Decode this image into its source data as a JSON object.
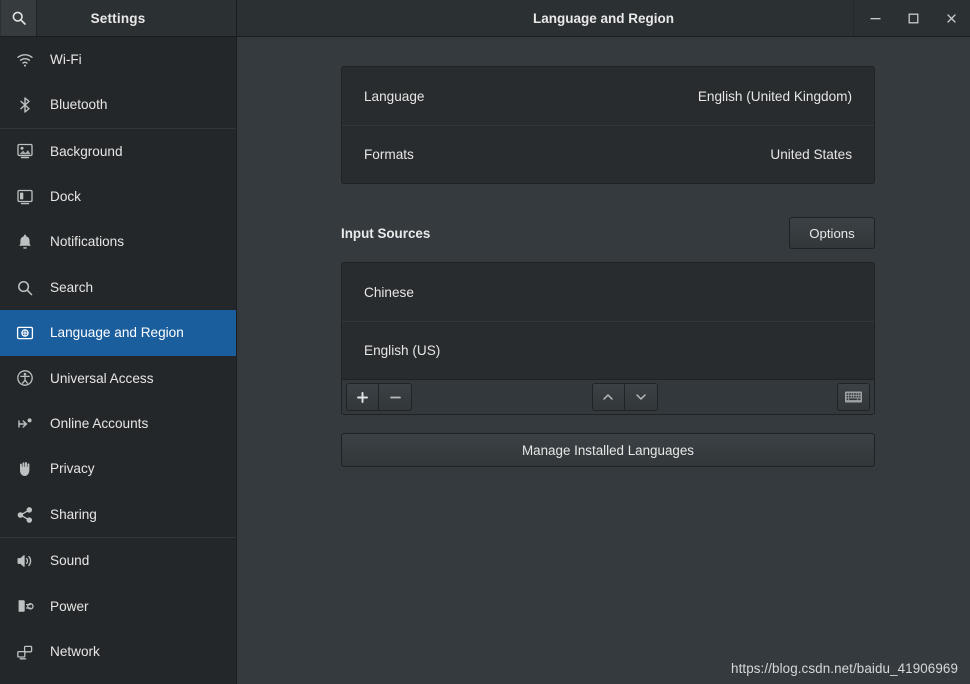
{
  "sidebar": {
    "title": "Settings",
    "search_icon": "search-icon",
    "items": [
      {
        "label": "Wi-Fi",
        "icon": "wifi-icon",
        "selected": false,
        "sep_after": false
      },
      {
        "label": "Bluetooth",
        "icon": "bluetooth-icon",
        "selected": false,
        "sep_after": true
      },
      {
        "label": "Background",
        "icon": "background-icon",
        "selected": false,
        "sep_after": false
      },
      {
        "label": "Dock",
        "icon": "dock-icon",
        "selected": false,
        "sep_after": false
      },
      {
        "label": "Notifications",
        "icon": "bell-icon",
        "selected": false,
        "sep_after": false
      },
      {
        "label": "Search",
        "icon": "search-icon",
        "selected": false,
        "sep_after": false
      },
      {
        "label": "Language and Region",
        "icon": "language-region-icon",
        "selected": true,
        "sep_after": false
      },
      {
        "label": "Universal Access",
        "icon": "accessibility-icon",
        "selected": false,
        "sep_after": false
      },
      {
        "label": "Online Accounts",
        "icon": "online-accounts-icon",
        "selected": false,
        "sep_after": false
      },
      {
        "label": "Privacy",
        "icon": "hand-icon",
        "selected": false,
        "sep_after": false
      },
      {
        "label": "Sharing",
        "icon": "share-icon",
        "selected": false,
        "sep_after": true
      },
      {
        "label": "Sound",
        "icon": "speaker-icon",
        "selected": false,
        "sep_after": false
      },
      {
        "label": "Power",
        "icon": "power-plug-icon",
        "selected": false,
        "sep_after": false
      },
      {
        "label": "Network",
        "icon": "network-icon",
        "selected": false,
        "sep_after": false
      }
    ]
  },
  "titlebar": {
    "title": "Language and Region",
    "minimize_label": "Minimize",
    "maximize_label": "Maximize",
    "close_label": "Close"
  },
  "main": {
    "language_card": {
      "rows": [
        {
          "key": "Language",
          "value": "English (United Kingdom)"
        },
        {
          "key": "Formats",
          "value": "United States"
        }
      ]
    },
    "input_sources": {
      "section_title": "Input Sources",
      "options_label": "Options",
      "sources": [
        {
          "label": "Chinese"
        },
        {
          "label": "English (US)"
        }
      ],
      "toolbar": {
        "add_label": "+",
        "remove_label": "−",
        "move_up_label": "Move up",
        "move_down_label": "Move down",
        "keyboard_label": "Show keyboard layout"
      }
    },
    "manage_languages_label": "Manage Installed Languages"
  },
  "watermark": "https://blog.csdn.net/baidu_41906969",
  "colors": {
    "accent_selection": "#1b5e9e",
    "sidebar_bg": "#242729",
    "main_bg": "#343a3d",
    "card_bg": "#282c2e",
    "header_bg": "#2b3033"
  }
}
